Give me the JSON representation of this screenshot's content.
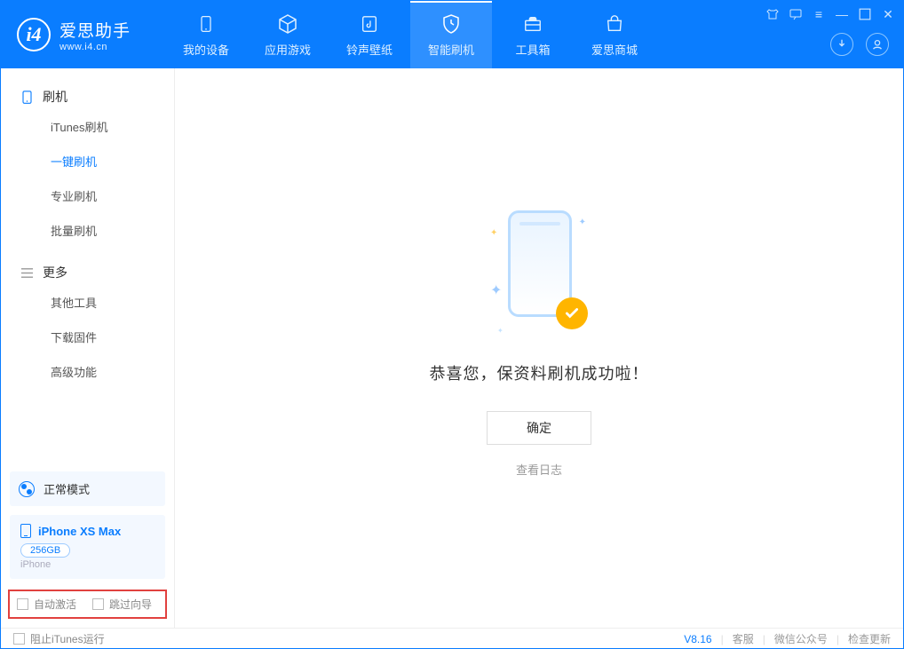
{
  "app": {
    "title": "爱思助手",
    "subtitle": "www.i4.cn"
  },
  "nav": [
    {
      "label": "我的设备",
      "icon": "device"
    },
    {
      "label": "应用游戏",
      "icon": "cube"
    },
    {
      "label": "铃声壁纸",
      "icon": "music"
    },
    {
      "label": "智能刷机",
      "icon": "shield",
      "active": true
    },
    {
      "label": "工具箱",
      "icon": "toolbox"
    },
    {
      "label": "爱思商城",
      "icon": "shop"
    }
  ],
  "sidebar": {
    "group1_label": "刷机",
    "group1_items": [
      "iTunes刷机",
      "一键刷机",
      "专业刷机",
      "批量刷机"
    ],
    "group1_active_index": 1,
    "group2_label": "更多",
    "group2_items": [
      "其他工具",
      "下载固件",
      "高级功能"
    ]
  },
  "device": {
    "mode_label": "正常模式",
    "name": "iPhone XS Max",
    "storage": "256GB",
    "type": "iPhone"
  },
  "bottom_checks": {
    "check1": "自动激活",
    "check2": "跳过向导"
  },
  "main": {
    "success_text": "恭喜您，保资料刷机成功啦！",
    "ok_button": "确定",
    "view_log": "查看日志"
  },
  "footer": {
    "block_itunes": "阻止iTunes运行",
    "version": "V8.16",
    "link1": "客服",
    "link2": "微信公众号",
    "link3": "检查更新"
  }
}
